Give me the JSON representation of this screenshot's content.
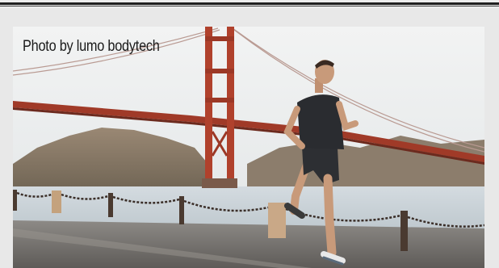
{
  "photo": {
    "credit": "Photo by lumo bodytech",
    "subject": "runner-on-waterfront-path",
    "landmark": "golden-gate-bridge"
  },
  "colors": {
    "page_background": "#e8e8e8",
    "top_rule": "#1e1e1e",
    "bridge": "#b0412c",
    "sky": "#eef0f1",
    "water": "#c9d2d8"
  }
}
